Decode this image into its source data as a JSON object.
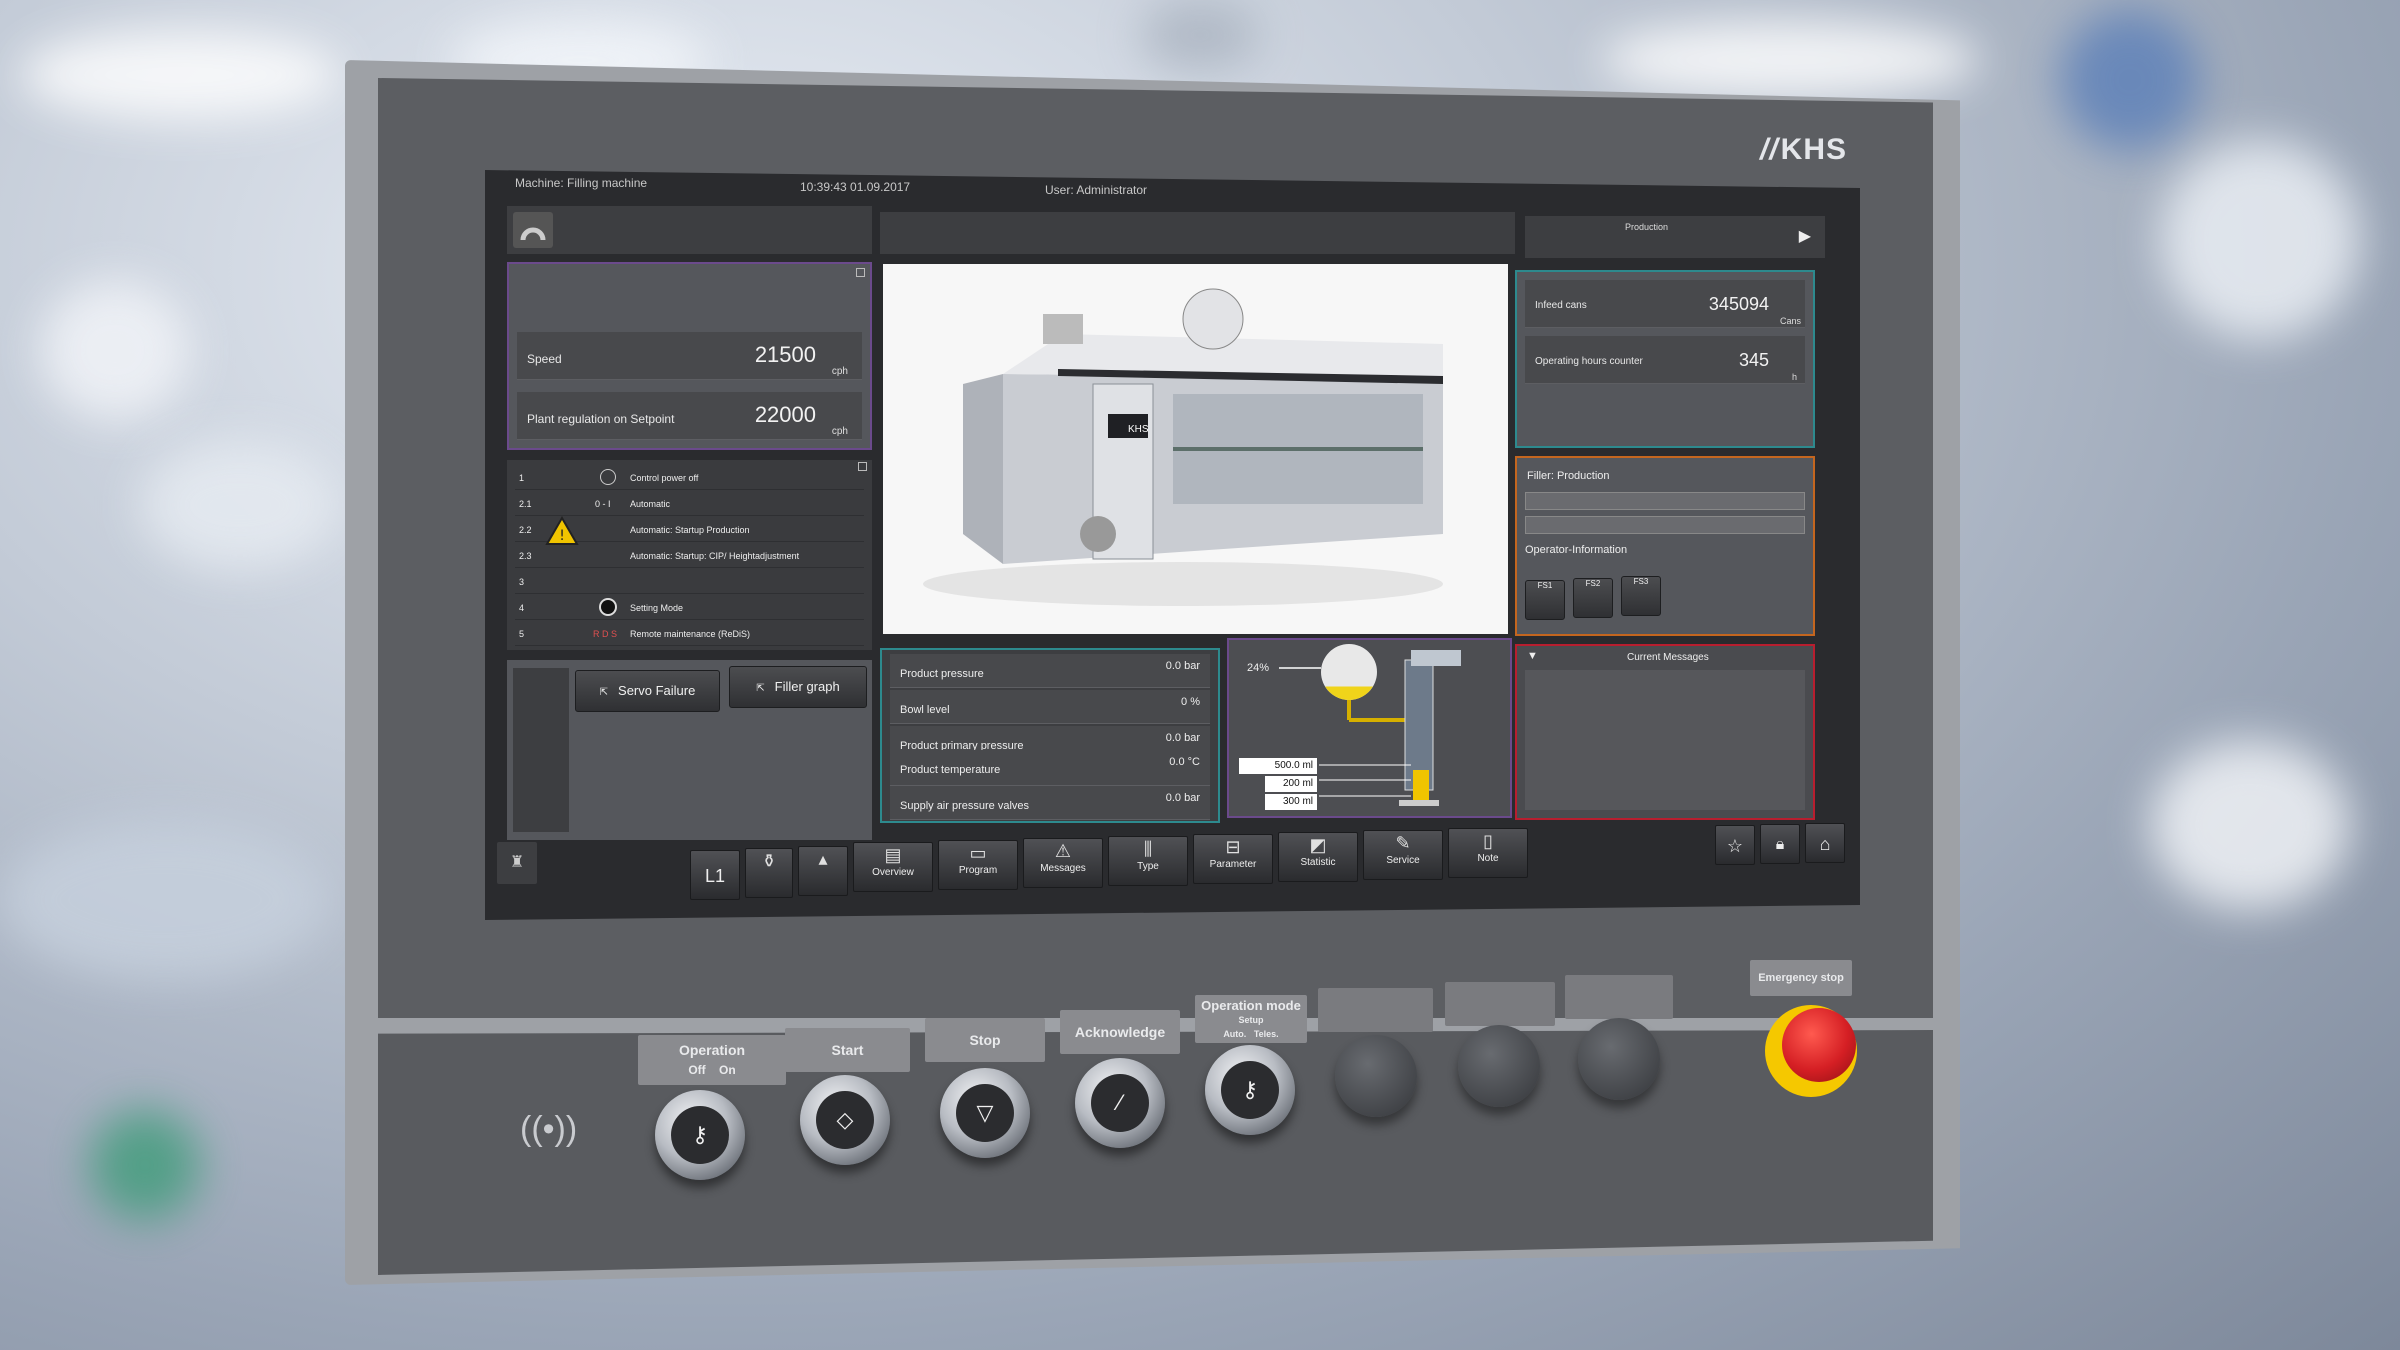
{
  "brand": {
    "logo": "KHS"
  },
  "header": {
    "machine": "Machine: Filling machine",
    "datetime": "10:39:43 01.09.2017",
    "user": "User: Administrator"
  },
  "top_right": {
    "mode": "Production"
  },
  "speed_panel": {
    "rows": [
      {
        "label": "Speed",
        "value": "21500",
        "unit": "cph"
      },
      {
        "label": "Plant regulation on Setpoint",
        "value": "22000",
        "unit": "cph"
      }
    ]
  },
  "steps": [
    {
      "num": "1",
      "sym": "",
      "label": "Control power off"
    },
    {
      "num": "2.1",
      "sym": "0 - I",
      "label": "Automatic"
    },
    {
      "num": "2.2",
      "sym": "",
      "label": "Automatic: Startup Production"
    },
    {
      "num": "2.3",
      "sym": "",
      "label": "Automatic: Startup: CIP/ Heightadjustment"
    },
    {
      "num": "3",
      "sym": "",
      "label": ""
    },
    {
      "num": "4",
      "sym": "",
      "label": "Setting Mode"
    },
    {
      "num": "5",
      "sym": "R D S",
      "label": "Remote maintenance (ReDiS)"
    }
  ],
  "action_buttons": {
    "servo": "Servo Failure",
    "filler": "Filler graph"
  },
  "counters": [
    {
      "label": "Infeed cans",
      "value": "345094",
      "unit": "Cans"
    },
    {
      "label": "Operating hours counter",
      "value": "345",
      "unit": "h"
    }
  ],
  "filler_panel": {
    "title": "Filler: Production",
    "operator": "Operator-Information",
    "keys": [
      "FS1",
      "FS2",
      "FS3"
    ]
  },
  "messages": {
    "title": "Current Messages"
  },
  "machine_image": {
    "label": "KHS"
  },
  "measurements": [
    {
      "name": "Product pressure",
      "value": "0.0 bar"
    },
    {
      "name": "Bowl level",
      "value": "0 %"
    },
    {
      "name": "Product primary pressure",
      "value": "0.0 bar"
    },
    {
      "name": "Product temperature",
      "value": "0.0 °C"
    },
    {
      "name": "Supply air pressure valves",
      "value": "0.0 bar"
    }
  ],
  "valve_diagram": {
    "level": "24%",
    "volumes": [
      "500.0 ml",
      "200 ml",
      "300 ml"
    ],
    "level_fraction": 0.24
  },
  "toolbar": {
    "line": "L1",
    "items": [
      {
        "label": "Overview",
        "icon": "overview-icon"
      },
      {
        "label": "Program",
        "icon": "program-icon"
      },
      {
        "label": "Messages",
        "icon": "warning-icon"
      },
      {
        "label": "Type",
        "icon": "bottles-icon"
      },
      {
        "label": "Parameter",
        "icon": "parameter-icon"
      },
      {
        "label": "Statistic",
        "icon": "chart-icon"
      },
      {
        "label": "Service",
        "icon": "wrench-icon"
      },
      {
        "label": "Note",
        "icon": "note-icon"
      }
    ]
  },
  "hardware": {
    "operation": "Operation",
    "off": "Off",
    "on": "On",
    "start": "Start",
    "stop": "Stop",
    "acknowledge": "Acknowledge",
    "opmode": "Operation mode",
    "setup": "Setup",
    "auto": "Auto.",
    "teles": "Teles.",
    "emergency": "Emergency stop"
  },
  "colors": {
    "accent_purple": "#6b4a8c",
    "accent_teal": "#2d8a8e",
    "accent_orange": "#c4661f",
    "accent_red": "#b81e2f",
    "estop": "#d51f24"
  }
}
